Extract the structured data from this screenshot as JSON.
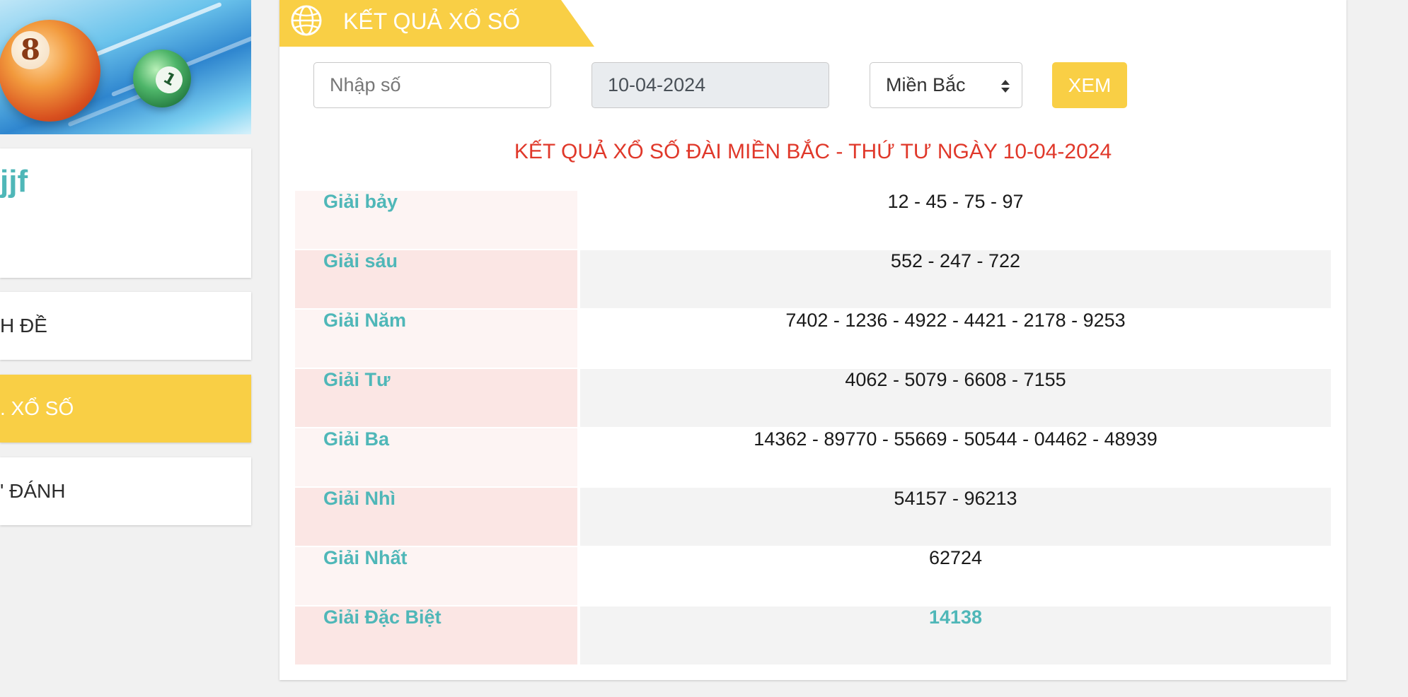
{
  "sidebar": {
    "username": "jjf",
    "menu": [
      {
        "label": "H ĐỀ"
      },
      {
        "label": ". XỔ SỐ"
      },
      {
        "label": "' ĐÁNH"
      }
    ]
  },
  "panel": {
    "header_title": "KẾT QUẢ XỔ SỐ",
    "search_placeholder": "Nhập số",
    "date_value": "10-04-2024",
    "region_selected": "Miền Bắc",
    "view_button": "XEM",
    "result_title": "KẾT QUẢ XỔ SỐ ĐÀI MIỀN BẮC - THỨ TƯ NGÀY 10-04-2024"
  },
  "prizes": [
    {
      "name": "Giải bảy",
      "numbers": "12 - 45 - 75 - 97"
    },
    {
      "name": "Giải sáu",
      "numbers": "552 - 247 - 722"
    },
    {
      "name": "Giải Năm",
      "numbers": "7402 - 1236 - 4922 - 4421 - 2178 - 9253"
    },
    {
      "name": "Giải Tư",
      "numbers": "4062 - 5079 - 6608 - 7155"
    },
    {
      "name": "Giải Ba",
      "numbers": "14362 - 89770 - 55669 - 50544 - 04462 - 48939"
    },
    {
      "name": "Giải Nhì",
      "numbers": "54157 - 96213"
    },
    {
      "name": "Giải Nhất",
      "numbers": "62724"
    },
    {
      "name": "Giải Đặc Biệt",
      "numbers": "14138"
    }
  ],
  "colors": {
    "accent": "#f9cf45",
    "teal": "#4fb7b8",
    "title_red": "#e0382a"
  }
}
